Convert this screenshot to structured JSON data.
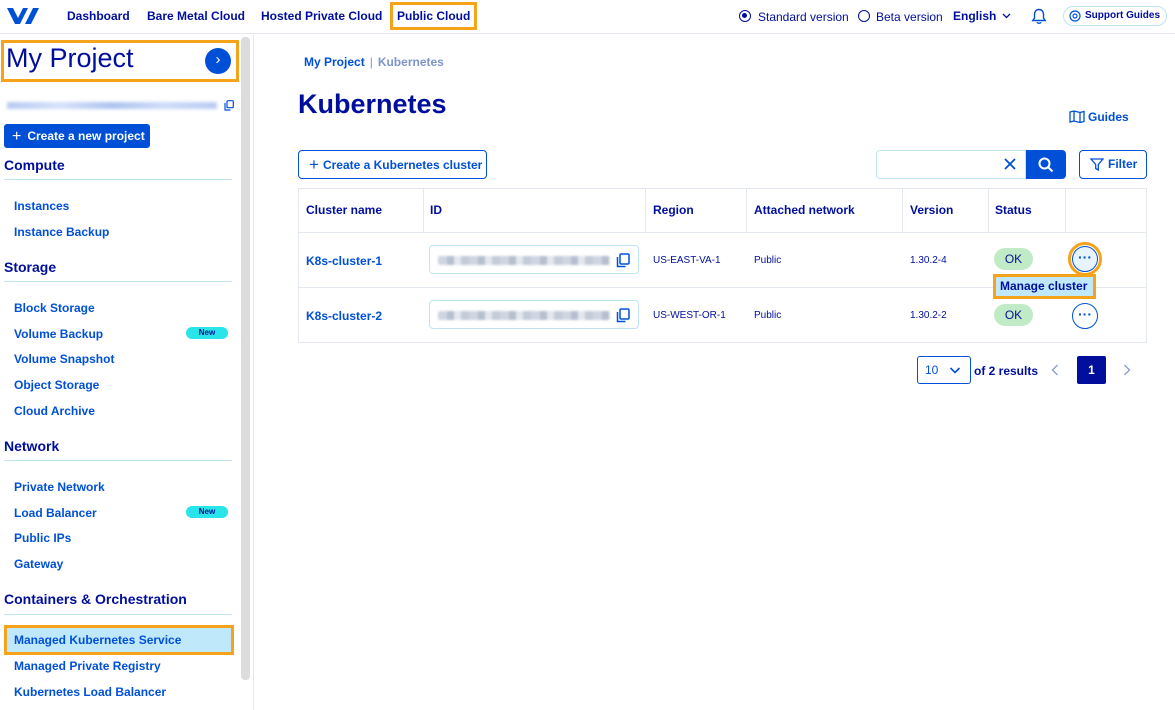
{
  "topnav": {
    "items": [
      {
        "label": "Dashboard"
      },
      {
        "label": "Bare Metal Cloud"
      },
      {
        "label": "Hosted Private Cloud"
      },
      {
        "label": "Public Cloud"
      }
    ],
    "version_standard": "Standard version",
    "version_beta": "Beta version",
    "language": "English",
    "support": "Support Guides"
  },
  "sidebar": {
    "project_title": "My Project",
    "create_project": "Create a new project",
    "new_badge": "New",
    "sections": [
      {
        "title": "Compute",
        "items": [
          {
            "label": "Instances"
          },
          {
            "label": "Instance Backup"
          }
        ]
      },
      {
        "title": "Storage",
        "items": [
          {
            "label": "Block Storage"
          },
          {
            "label": "Volume Backup"
          },
          {
            "label": "Volume Snapshot"
          },
          {
            "label": "Object Storage"
          },
          {
            "label": "Cloud Archive"
          }
        ]
      },
      {
        "title": "Network",
        "items": [
          {
            "label": "Private Network"
          },
          {
            "label": "Load Balancer"
          },
          {
            "label": "Public IPs"
          },
          {
            "label": "Gateway"
          }
        ]
      },
      {
        "title": "Containers & Orchestration",
        "items": [
          {
            "label": "Managed Kubernetes Service"
          },
          {
            "label": "Managed Private Registry"
          },
          {
            "label": "Kubernetes Load Balancer"
          }
        ]
      }
    ]
  },
  "breadcrumb": {
    "root": "My Project",
    "separator": "|",
    "current": "Kubernetes"
  },
  "page": {
    "title": "Kubernetes",
    "guides": "Guides",
    "create_cluster": "Create a Kubernetes cluster",
    "search_value": "",
    "filter": "Filter"
  },
  "table": {
    "headers": [
      "Cluster name",
      "ID",
      "Region",
      "Attached network",
      "Version",
      "Status"
    ],
    "rows": [
      {
        "name": "K8s-cluster-1",
        "region": "US-EAST-VA-1",
        "network": "Public",
        "version": "1.30.2-4",
        "status": "OK",
        "actions": "···"
      },
      {
        "name": "K8s-cluster-2",
        "region": "US-WEST-OR-1",
        "network": "Public",
        "version": "1.30.2-2",
        "status": "OK",
        "actions": "···"
      }
    ],
    "tooltip": "Manage cluster"
  },
  "pagination": {
    "per_page": "10",
    "summary": "of 2 results",
    "page": "1"
  },
  "colors": {
    "brand": "#000e9c",
    "link": "#0050d7",
    "highlight": "#f5a31a",
    "ok_badge": "#c1ebc6",
    "new_badge": "#27e5e8"
  }
}
